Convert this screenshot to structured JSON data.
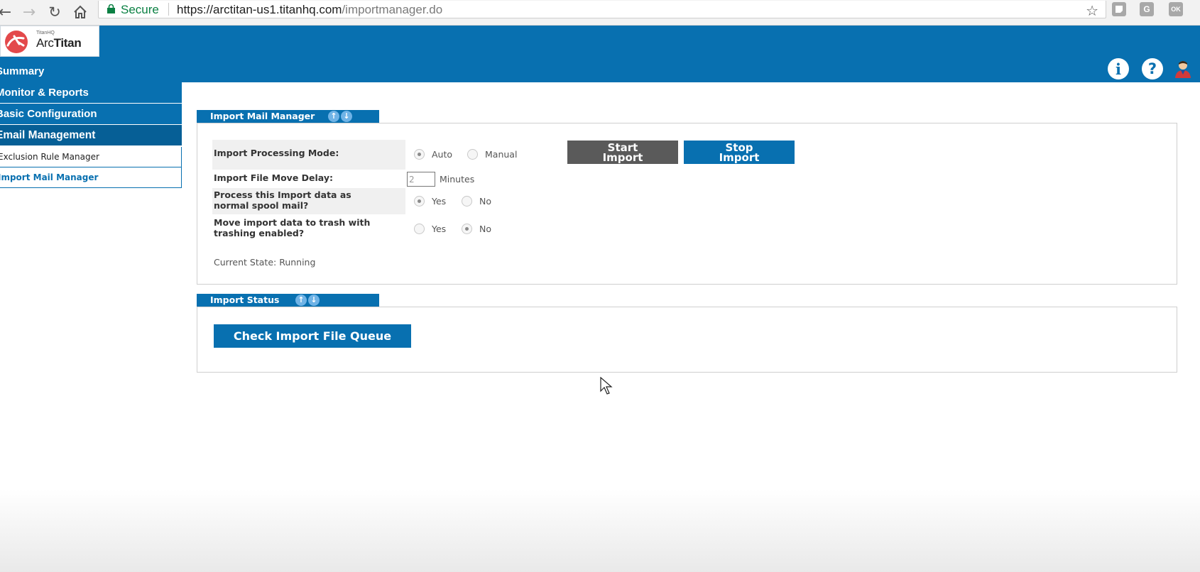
{
  "browser": {
    "secure_label": "Secure",
    "url_host": "https://arctitan-us1.titanhq.com",
    "url_path": "/importmanager.do",
    "extensions": [
      "G",
      "OK"
    ]
  },
  "header": {
    "logo_small": "TitanHQ",
    "logo_brand_light": "Arc",
    "logo_brand_bold": "Titan",
    "info_icon_glyph": "i",
    "help_icon_glyph": "?"
  },
  "sidebar": {
    "items": [
      {
        "label": "Summary"
      },
      {
        "label": "Monitor & Reports"
      },
      {
        "label": "Basic Configuration"
      },
      {
        "label": "Email Management"
      }
    ],
    "sub_items": [
      {
        "label": "Exclusion Rule Manager",
        "active": false
      },
      {
        "label": "Import Mail Manager",
        "active": true
      }
    ]
  },
  "import_mail_manager": {
    "title": "Import Mail Manager",
    "processing_mode": {
      "label": "Import Processing Mode:",
      "options": [
        "Auto",
        "Manual"
      ],
      "selected": "Auto"
    },
    "file_move_delay": {
      "label": "Import File Move Delay:",
      "value": "2",
      "unit": "Minutes"
    },
    "spool_mail": {
      "label_line1": "Process this Import data as",
      "label_line2": "normal spool mail?",
      "options": [
        "Yes",
        "No"
      ],
      "selected": "Yes"
    },
    "trash": {
      "label_line1": "Move import data to trash with",
      "label_line2": "trashing enabled?",
      "options": [
        "Yes",
        "No"
      ],
      "selected": "No"
    },
    "start_button_line1": "Start",
    "start_button_line2": "Import",
    "stop_button_line1": "Stop",
    "stop_button_line2": "Import",
    "current_state": "Current State: Running"
  },
  "import_status": {
    "title": "Import Status",
    "check_queue_button": "Check Import File Queue"
  },
  "colors": {
    "brand_blue": "#0870b0",
    "start_button": "#5a5a5a",
    "arrow_blue": "#6fb3e6"
  }
}
